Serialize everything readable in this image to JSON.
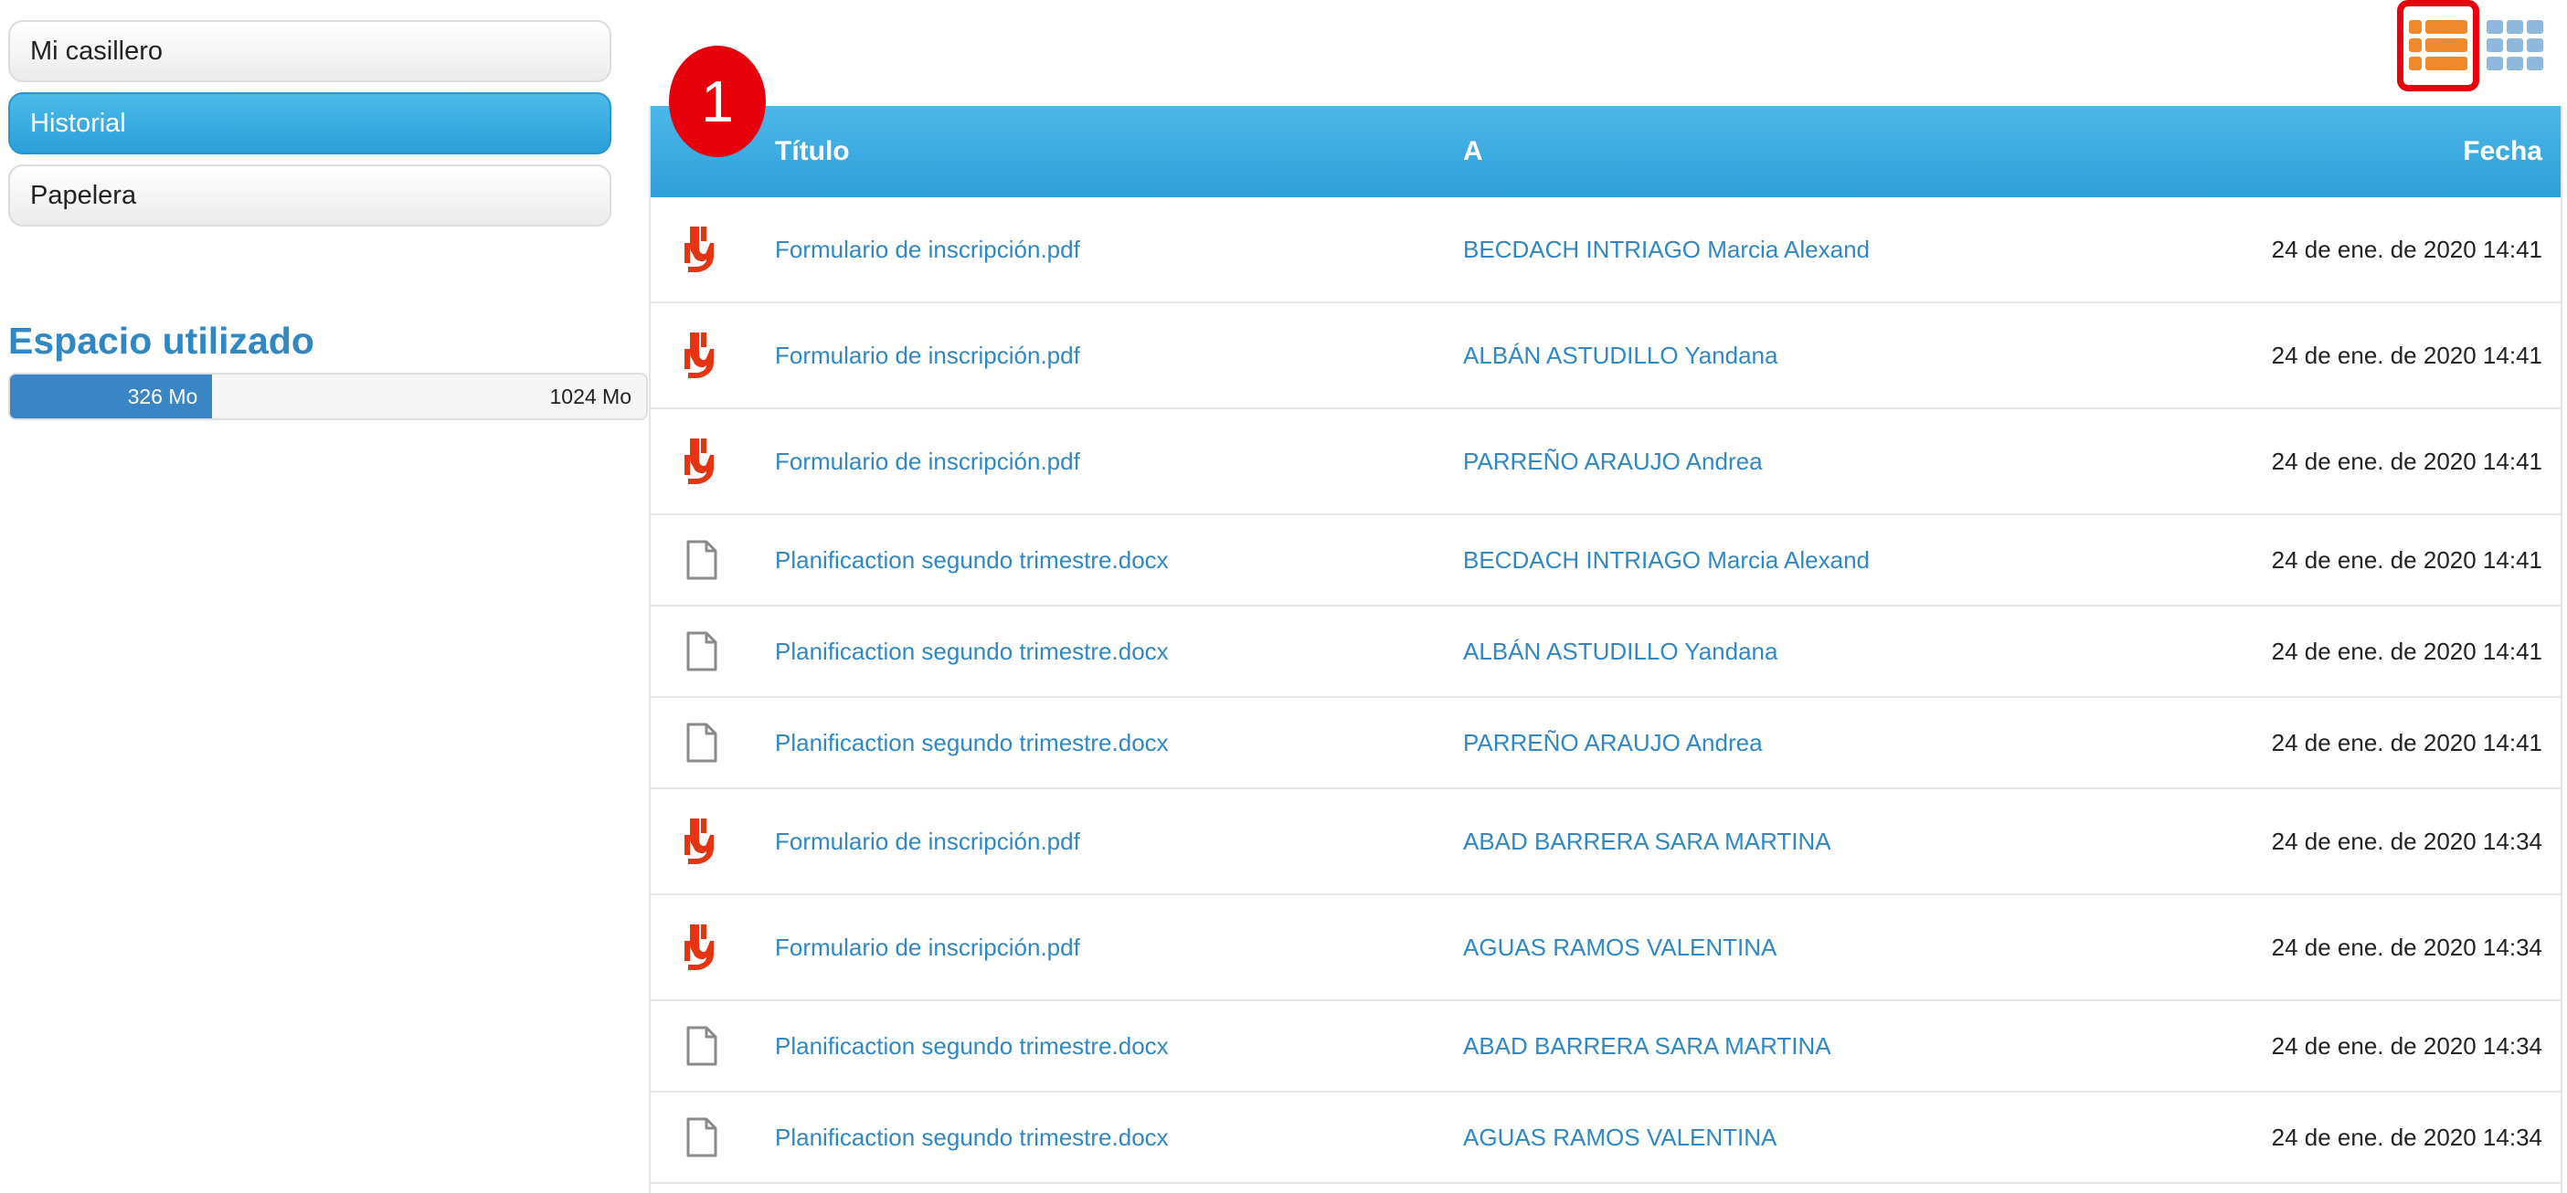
{
  "sidebar": {
    "items": [
      {
        "label": "Mi casillero",
        "active": false
      },
      {
        "label": "Historial",
        "active": true
      },
      {
        "label": "Papelera",
        "active": false
      }
    ]
  },
  "storage": {
    "title": "Espacio utilizado",
    "used_label": "326 Mo",
    "total_label": "1024 Mo",
    "used_fraction": 0.318
  },
  "view_toggles": {
    "list_icon": "list-view-icon",
    "grid_icon": "grid-view-icon",
    "active": "list"
  },
  "annotation": {
    "step_label": "1"
  },
  "table": {
    "headers": {
      "title": "Título",
      "to": "A",
      "date": "Fecha"
    },
    "rows": [
      {
        "type": "pdf",
        "icon": "pdf-icon",
        "title": "Formulario de inscripción.pdf",
        "to": "BECDACH INTRIAGO Marcia Alexand",
        "date": "24 de ene. de 2020 14:41"
      },
      {
        "type": "pdf",
        "icon": "pdf-icon",
        "title": "Formulario de inscripción.pdf",
        "to": "ALBÁN ASTUDILLO Yandana",
        "date": "24 de ene. de 2020 14:41"
      },
      {
        "type": "pdf",
        "icon": "pdf-icon",
        "title": "Formulario de inscripción.pdf",
        "to": "PARREÑO ARAUJO Andrea",
        "date": "24 de ene. de 2020 14:41"
      },
      {
        "type": "doc",
        "icon": "document-icon",
        "title": "Planificaction segundo trimestre.docx",
        "to": "BECDACH INTRIAGO Marcia Alexand",
        "date": "24 de ene. de 2020 14:41"
      },
      {
        "type": "doc",
        "icon": "document-icon",
        "title": "Planificaction segundo trimestre.docx",
        "to": "ALBÁN ASTUDILLO Yandana",
        "date": "24 de ene. de 2020 14:41"
      },
      {
        "type": "doc",
        "icon": "document-icon",
        "title": "Planificaction segundo trimestre.docx",
        "to": "PARREÑO ARAUJO Andrea",
        "date": "24 de ene. de 2020 14:41"
      },
      {
        "type": "pdf",
        "icon": "pdf-icon",
        "title": "Formulario de inscripción.pdf",
        "to": "ABAD BARRERA SARA MARTINA",
        "date": "24 de ene. de 2020 14:34"
      },
      {
        "type": "pdf",
        "icon": "pdf-icon",
        "title": "Formulario de inscripción.pdf",
        "to": "AGUAS RAMOS VALENTINA",
        "date": "24 de ene. de 2020 14:34"
      },
      {
        "type": "doc",
        "icon": "document-icon",
        "title": "Planificaction segundo trimestre.docx",
        "to": "ABAD BARRERA SARA MARTINA",
        "date": "24 de ene. de 2020 14:34"
      },
      {
        "type": "doc",
        "icon": "document-icon",
        "title": "Planificaction segundo trimestre.docx",
        "to": "AGUAS RAMOS VALENTINA",
        "date": "24 de ene. de 2020 14:34"
      }
    ]
  },
  "colors": {
    "accent": "#2f88c4",
    "header_blue": "#3aaae0",
    "toggle_orange": "#f0892b",
    "toggle_blue": "#8fb8df",
    "pdf_red": "#e63312",
    "badge_red": "#e8000c"
  }
}
